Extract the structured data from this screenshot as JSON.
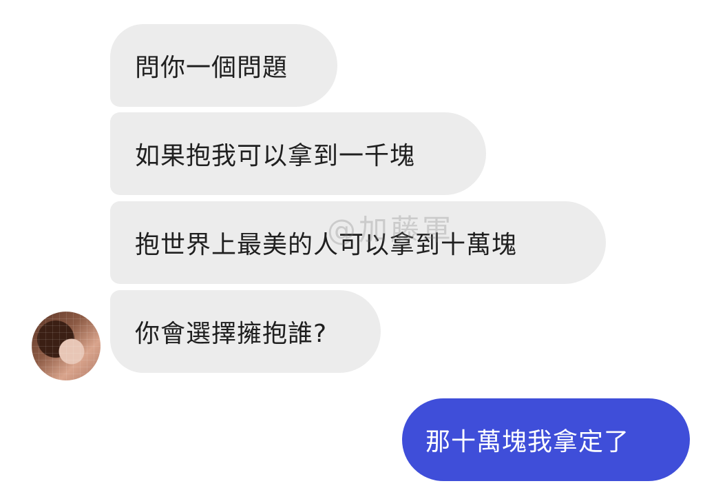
{
  "chat": {
    "incoming_messages": [
      "問你一個問題",
      "如果抱我可以拿到一千塊",
      "抱世界上最美的人可以拿到十萬塊",
      "你會選擇擁抱誰?"
    ],
    "outgoing_messages": [
      "那十萬塊我拿定了"
    ]
  },
  "watermark": "@加藤軍",
  "colors": {
    "incoming_bubble": "#ececec",
    "outgoing_bubble": "#3f4ed9",
    "background": "#ffffff"
  },
  "icons": {
    "avatar": "avatar-icon"
  }
}
